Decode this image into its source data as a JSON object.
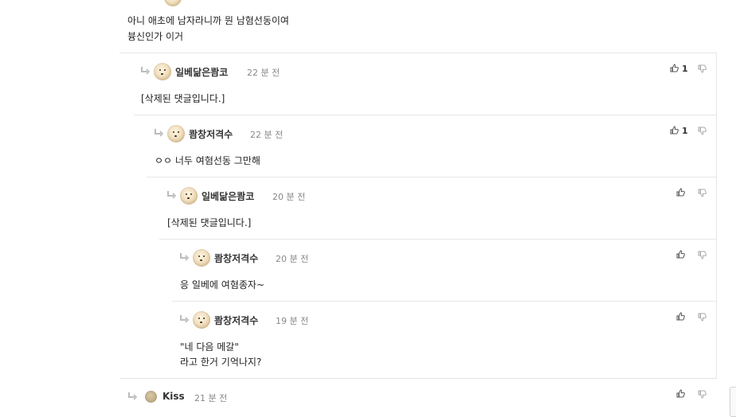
{
  "top_comment": {
    "lines": [
      "아니 애초에 남자라니까 뭔 남혐선동이여",
      "븅신인가 이거"
    ]
  },
  "comments": [
    {
      "nickname": "일베닮은쾀코",
      "time": "22 분 전",
      "body": [
        "[삭제된 댓글입니다.]"
      ],
      "likes": "1"
    },
    {
      "nickname": "쾀창저격수",
      "time": "22 분 전",
      "body": [
        "ㅇㅇ 너두 여혐선동 그만해"
      ],
      "likes": "1"
    },
    {
      "nickname": "일베닮은쾀코",
      "time": "20 분 전",
      "body": [
        "[삭제된 댓글입니다.]"
      ],
      "likes": ""
    },
    {
      "nickname": "쾀창저격수",
      "time": "20 분 전",
      "body": [
        "응 일베에 여혐종자~"
      ],
      "likes": ""
    },
    {
      "nickname": "쾀창저격수",
      "time": "19 분 전",
      "body": [
        "\"네 다음 메갈\"",
        "라고 한거 기억나지?"
      ],
      "likes": ""
    },
    {
      "nickname": "Kiss",
      "time": "21 분 전",
      "body": [],
      "likes": ""
    }
  ],
  "icons": {
    "reply": "reply-arrow-icon",
    "avatar": "avatar-icon",
    "like": "thumbs-up-icon",
    "dislike": "thumbs-down-icon"
  },
  "colors": {
    "divider": "#e6e6e6",
    "text": "#222222",
    "muted": "#888888",
    "icon": "#999999"
  }
}
